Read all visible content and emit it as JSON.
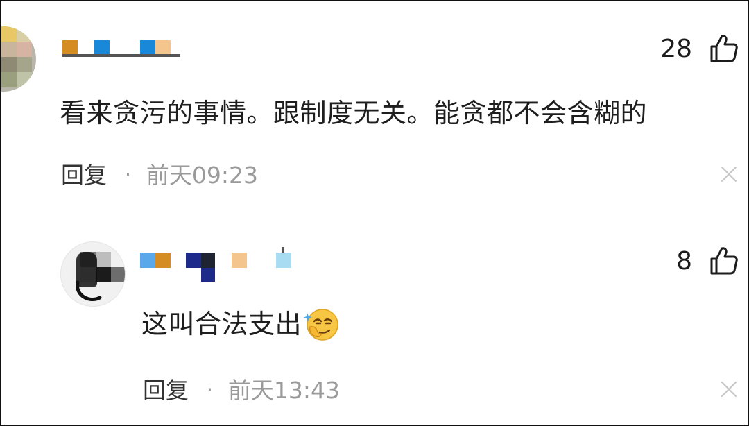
{
  "comments": [
    {
      "likes": "28",
      "text": "看来贪污的事情。跟制度无关。能贪都不会含糊的",
      "reply_label": "回复",
      "separator": "·",
      "time": "前天09:23",
      "avatar": "blurred-avatar",
      "username": "mosaic-redacted"
    },
    {
      "likes": "8",
      "text": "这叫合法支出",
      "emoji": "smirk-emoji",
      "reply_label": "回复",
      "separator": "·",
      "time": "前天13:43",
      "avatar": "blurred-avatar",
      "username": "mosaic-redacted"
    }
  ],
  "icons": {
    "like": "thumbs-up-icon",
    "close": "close-icon"
  },
  "colors": {
    "text": "#1e1e1e",
    "meta": "#9a9a9a",
    "border": "#111111"
  }
}
